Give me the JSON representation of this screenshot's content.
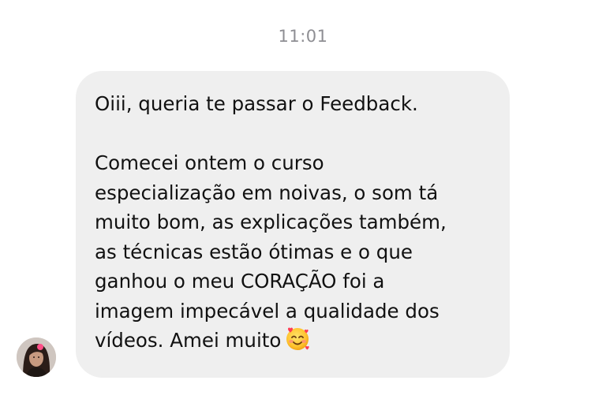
{
  "chat": {
    "timestamp": "11:01",
    "message": {
      "paragraph1": "Oiii, queria te passar o Feedback.",
      "paragraph2_lines": [
        "Comecei ontem o curso",
        "especialização em noivas, o som tá",
        "muito bom, as explicações também,",
        "as técnicas estão ótimas e o que",
        "ganhou o meu CORAÇÃO foi a",
        "imagem impecável a qualidade dos",
        "vídeos. Amei muito"
      ],
      "emoji": "smiling-face-with-hearts"
    },
    "sender_avatar": "contact-avatar-photo"
  },
  "colors": {
    "bubble": "#efefef",
    "text": "#111111",
    "timestamp": "#8e8e93"
  }
}
